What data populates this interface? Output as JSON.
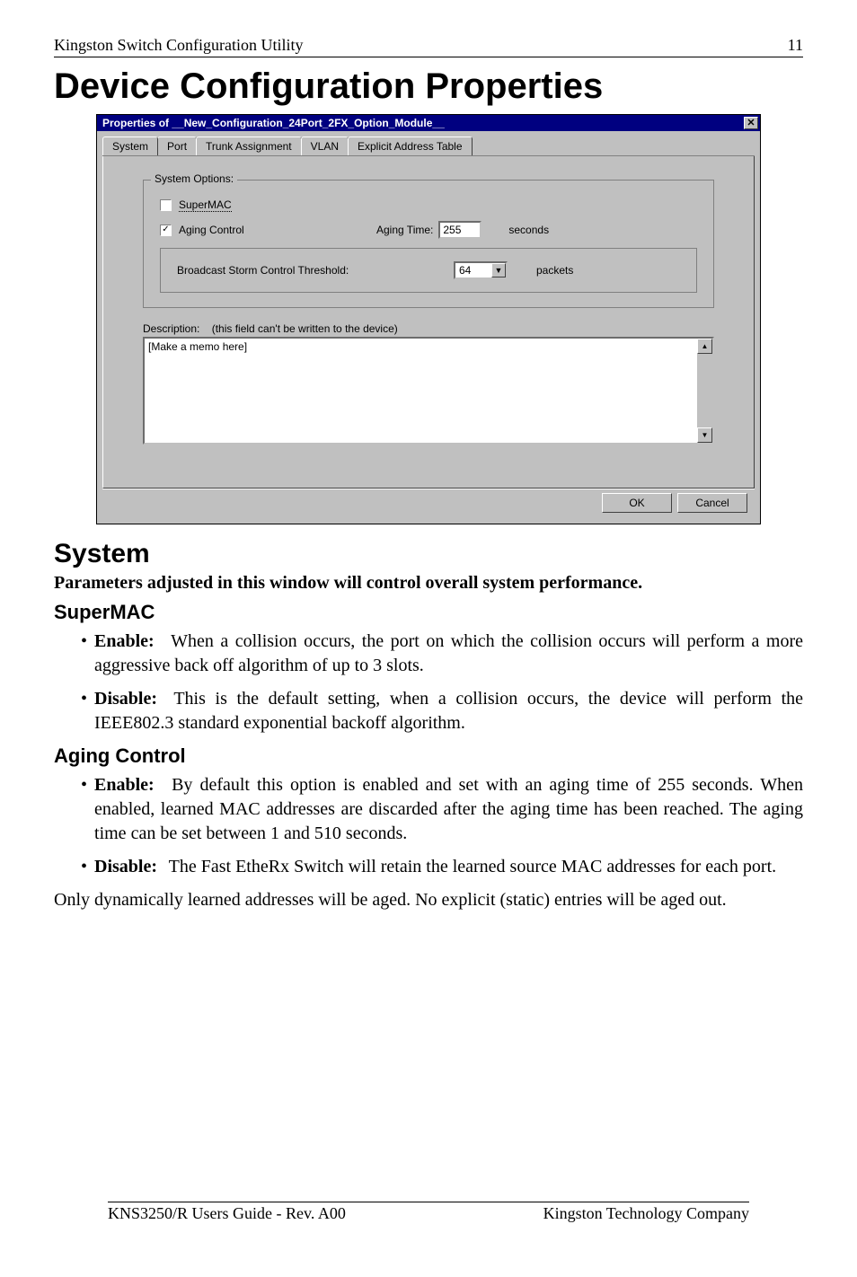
{
  "header": {
    "left": "Kingston Switch Configuration Utility",
    "right": "11"
  },
  "title": "Device Configuration Properties",
  "dialog": {
    "title": "Properties of __New_Configuration_24Port_2FX_Option_Module__",
    "tabs": [
      "System",
      "Port",
      "Trunk Assignment",
      "VLAN",
      "Explicit Address Table"
    ],
    "group_label": "System Options:",
    "supermac_label": "SuperMAC",
    "aging_label": "Aging Control",
    "aging_time_label": "Aging Time:",
    "aging_time_value": "255",
    "aging_unit": "seconds",
    "bcast_label": "Broadcast Storm Control Threshold:",
    "bcast_value": "64",
    "bcast_unit": "packets",
    "desc_label": "Description:",
    "desc_hint": "(this field can't be written to the device)",
    "desc_value": "[Make a memo here]",
    "ok": "OK",
    "cancel": "Cancel"
  },
  "section_title": "System",
  "intro": "Parameters adjusted in this window will control overall system performance.",
  "supermac_heading": "SuperMAC",
  "supermac_items": [
    {
      "kw": "Enable",
      "text": "When a collision occurs, the port on which the collision occurs will perform a more aggressive back off algorithm of up to 3 slots."
    },
    {
      "kw": "Disable",
      "text": "This is the default setting, when a collision occurs, the device will perform the IEEE802.3 standard exponential backoff algorithm."
    }
  ],
  "aging_heading": "Aging Control",
  "aging_items": [
    {
      "kw": "Enable",
      "text": "By default this option is enabled and set with an aging time of 255 seconds. When enabled, learned MAC addresses are discarded after the aging time has been reached. The aging time can be set between 1 and 510 seconds."
    },
    {
      "kw": "Disable",
      "text": "The Fast EtheRx Switch will retain the learned source MAC addresses for each port."
    }
  ],
  "closing": "Only dynamically learned addresses will be aged. No explicit (static) entries will be aged out.",
  "footer": {
    "left": "KNS3250/R Users Guide - Rev. A00",
    "right": "Kingston Technology Company"
  }
}
